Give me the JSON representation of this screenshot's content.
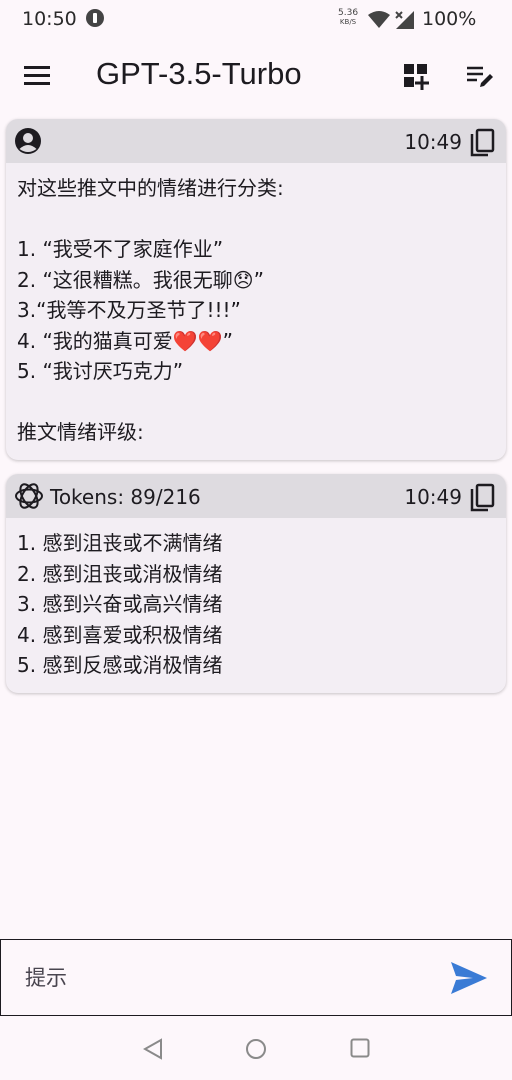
{
  "status_bar": {
    "time": "10:50",
    "net_speed_value": "5.36",
    "net_speed_unit": "KB/S",
    "battery": "100%"
  },
  "app_bar": {
    "title": "GPT-3.5-Turbo"
  },
  "messages": [
    {
      "role": "user",
      "time": "10:49",
      "text": "对这些推文中的情绪进行分类:\n\n1. “我受不了家庭作业”\n2. “这很糟糕。我很无聊😞”\n3.“我等不及万圣节了!!!”\n4. “我的猫真可爱❤️❤️”\n5. “我讨厌巧克力”\n\n推文情绪评级:"
    },
    {
      "role": "assistant",
      "tokens": "Tokens: 89/216",
      "time": "10:49",
      "text": "1. 感到沮丧或不满情绪\n2. 感到沮丧或消极情绪\n3. 感到兴奋或高兴情绪\n4. 感到喜爱或积极情绪\n5. 感到反感或消极情绪"
    }
  ],
  "input": {
    "placeholder": "提示",
    "value": ""
  },
  "colors": {
    "background": "#fdf7fb",
    "card": "#f3eef4",
    "card_header": "#dedbe0",
    "send_accent": "#3a7bd5"
  },
  "icons": [
    "menu-icon",
    "add-widget-icon",
    "edit-list-icon",
    "user-avatar-icon",
    "gpt-logo-icon",
    "copy-icon",
    "send-icon",
    "nav-back-icon",
    "nav-home-icon",
    "nav-recents-icon"
  ]
}
